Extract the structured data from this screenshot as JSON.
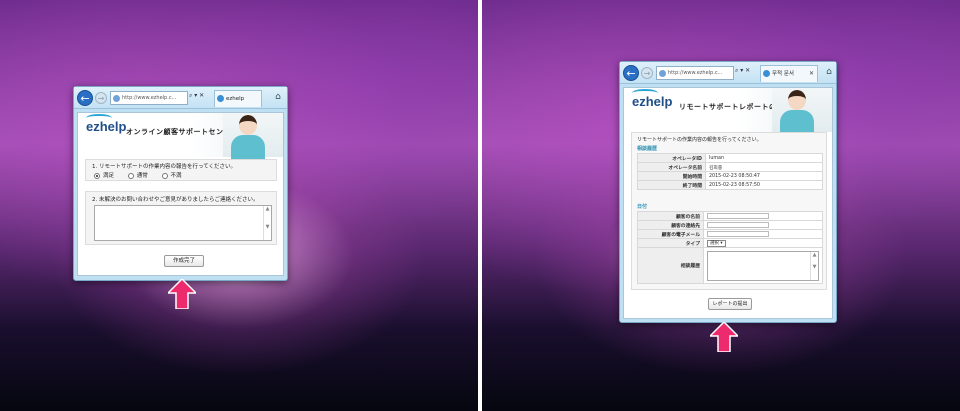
{
  "left": {
    "browser": {
      "url": "http://www.ezhelp.c...",
      "addr_tools": "⌕ ▾ ✕",
      "tab_title": "ezhelp"
    },
    "banner": {
      "logo": "ezhelp",
      "title": "オンライン顧客サポートセンター"
    },
    "form": {
      "q1": "1. リモートサポートの作業内容の報告を行ってください。",
      "options": [
        "満足",
        "通常",
        "不満"
      ],
      "q2": "2. 未解決のお問い合わせやご意見がありましたらご連絡ください。",
      "submit_label": "作成完了"
    }
  },
  "right": {
    "browser": {
      "url": "http://www.ezhelp.c...",
      "addr_tools": "⌕ ▾ ✕",
      "tab_title": "무적 문서"
    },
    "banner": {
      "logo": "ezhelp",
      "title": "リモートサポートレポートの作成"
    },
    "report": {
      "intro": "リモートサポートの作業内容の報告を行ってください。",
      "section1": "相談履歴",
      "rows1": [
        {
          "k": "オペレータID",
          "v": "luman"
        },
        {
          "k": "オペレータ名前",
          "v": "김희중"
        },
        {
          "k": "開始時間",
          "v": "2015-02-23 08:50:47"
        },
        {
          "k": "終了時間",
          "v": "2015-02-23 08:57:50"
        }
      ],
      "section2": "日付",
      "rows2": [
        {
          "k": "顧客の名前"
        },
        {
          "k": "顧客の連絡先"
        },
        {
          "k": "顧客の電子メール"
        }
      ],
      "type_label": "タイプ",
      "type_value": "選択",
      "history_label": "相談履歴",
      "submit_label": "レポートの提出"
    }
  },
  "colors": {
    "arrow": "#ee2a6e",
    "chrome": "#c3e2f4",
    "section_head": "#2a8fb0"
  }
}
